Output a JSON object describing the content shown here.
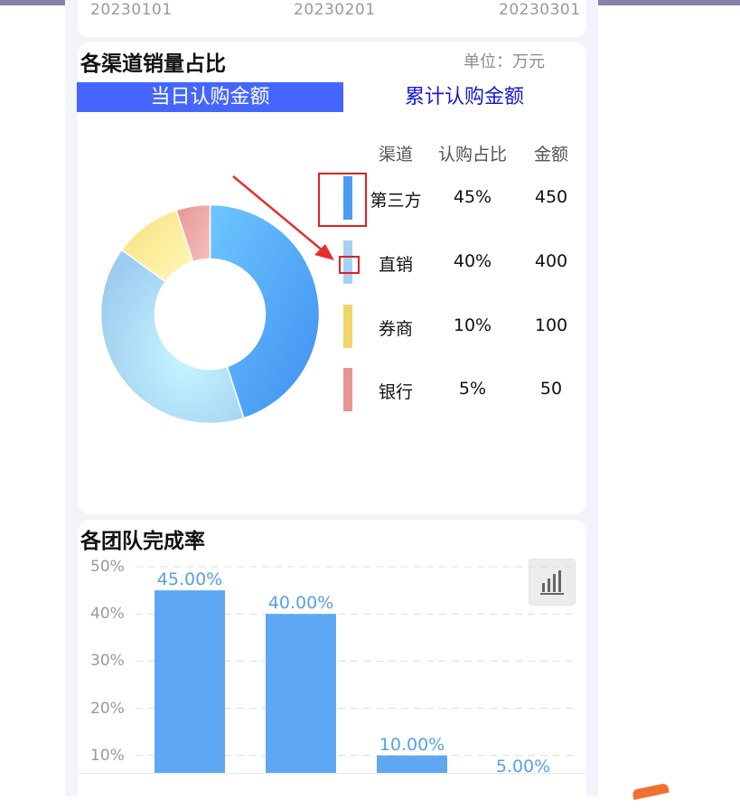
{
  "top_dates": [
    "20230101",
    "20230201",
    "20230301"
  ],
  "pie_section": {
    "title": "各渠道销量占比",
    "unit": "单位：万元",
    "tabs": [
      {
        "label": "当日认购金额",
        "active": true
      },
      {
        "label": "累计认购金额",
        "active": false
      }
    ],
    "table_headers": [
      "渠道",
      "认购占比",
      "金额"
    ]
  },
  "bar_section": {
    "title": "各团队完成率",
    "icon": "bar-chart-icon"
  },
  "chart_data": [
    {
      "type": "pie",
      "categories": [
        "第三方",
        "直销",
        "券商",
        "银行"
      ],
      "percent_labels": [
        "45%",
        "40%",
        "10%",
        "5%"
      ],
      "values": [
        450,
        400,
        100,
        50
      ],
      "colors": [
        "#4c9bf0",
        "#a8d0f2",
        "#f2d56a",
        "#e89592"
      ],
      "donut": true
    },
    {
      "type": "bar",
      "values": [
        45.0,
        40.0,
        10.0,
        5.0
      ],
      "labels": [
        "45.00%",
        "40.00%",
        "10.00%",
        "5.00%"
      ],
      "yticks": [
        "10%",
        "20%",
        "30%",
        "40%",
        "50%"
      ],
      "ylim": [
        0,
        50
      ],
      "color": "#5ea8f3",
      "label_color": "#5a9ee8",
      "grid": "dashed"
    }
  ]
}
